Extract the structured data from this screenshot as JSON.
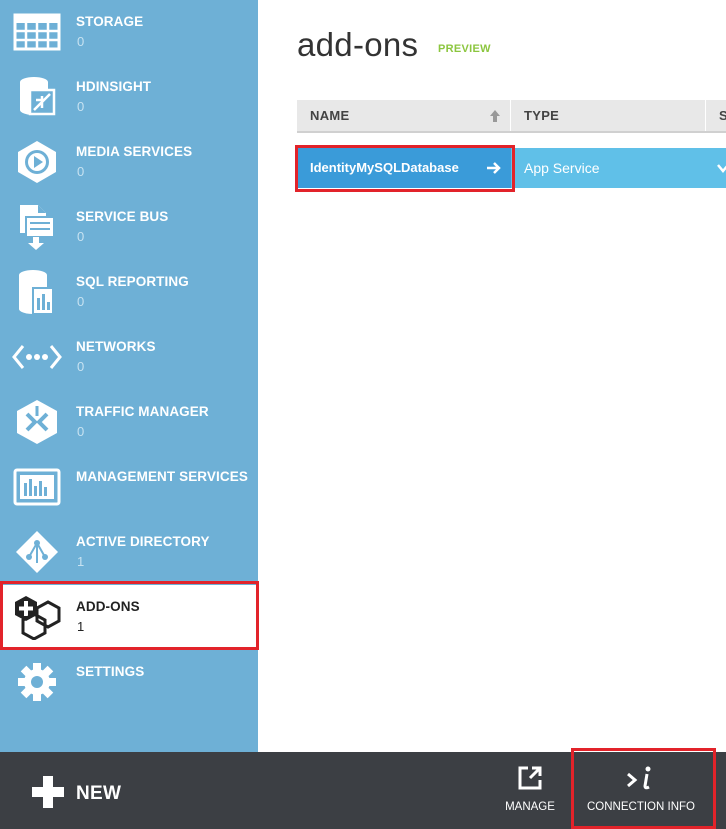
{
  "sidebar": {
    "items": [
      {
        "label": "STORAGE",
        "count": "0",
        "icon": "storage-table-icon"
      },
      {
        "label": "HDINSIGHT",
        "count": "0",
        "icon": "hdinsight-icon"
      },
      {
        "label": "MEDIA SERVICES",
        "count": "0",
        "icon": "media-services-icon"
      },
      {
        "label": "SERVICE BUS",
        "count": "0",
        "icon": "service-bus-icon"
      },
      {
        "label": "SQL REPORTING",
        "count": "0",
        "icon": "sql-reporting-icon"
      },
      {
        "label": "NETWORKS",
        "count": "0",
        "icon": "networks-icon"
      },
      {
        "label": "TRAFFIC MANAGER",
        "count": "0",
        "icon": "traffic-manager-icon"
      },
      {
        "label": "MANAGEMENT SERVICES",
        "count": "",
        "icon": "management-services-icon"
      },
      {
        "label": "ACTIVE DIRECTORY",
        "count": "1",
        "icon": "active-directory-icon"
      },
      {
        "label": "ADD-ONS",
        "count": "1",
        "icon": "add-ons-icon"
      },
      {
        "label": "SETTINGS",
        "count": "",
        "icon": "settings-gear-icon"
      }
    ],
    "selected_index": 9
  },
  "main": {
    "title": "add-ons",
    "badge": "PREVIEW",
    "columns": [
      "NAME",
      "TYPE",
      "S"
    ],
    "rows": [
      {
        "name": "IdentityMySQLDatabase",
        "type": "App Service"
      }
    ]
  },
  "bottombar": {
    "new_label": "NEW",
    "manage_label": "MANAGE",
    "connection_info_label": "CONNECTION INFO"
  },
  "colors": {
    "sidebar": "#6eb0d6",
    "row_selected": "#3a9bd9",
    "row_bg": "#60c0e8",
    "bottombar": "#3c3f44",
    "highlight": "#e2232a",
    "preview": "#8cc63f"
  }
}
